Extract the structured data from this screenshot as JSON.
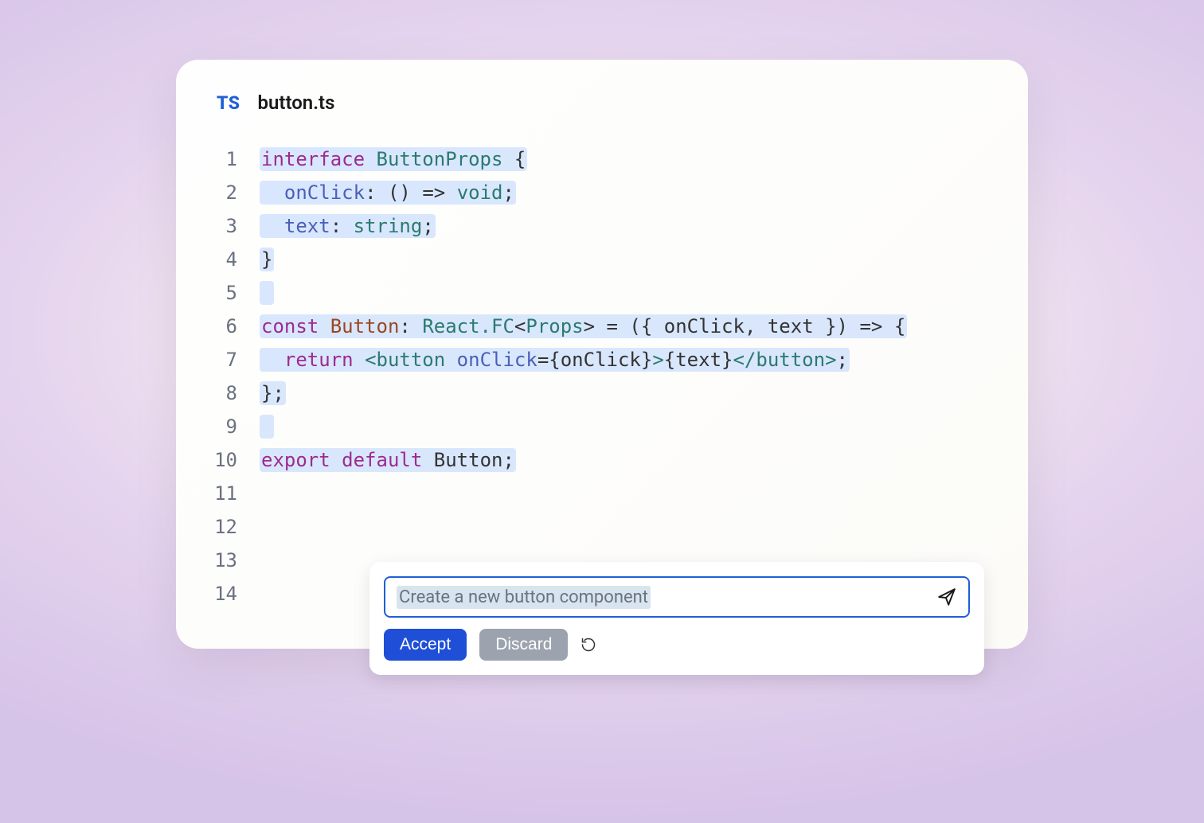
{
  "file": {
    "language_badge": "TS",
    "name": "button.ts"
  },
  "code": {
    "line_count": 14,
    "lines": {
      "l1": {
        "n": "1"
      },
      "l2": {
        "n": "2"
      },
      "l3": {
        "n": "3"
      },
      "l4": {
        "n": "4"
      },
      "l5": {
        "n": "5"
      },
      "l6": {
        "n": "6"
      },
      "l7": {
        "n": "7"
      },
      "l8": {
        "n": "8"
      },
      "l9": {
        "n": "9"
      },
      "l10": {
        "n": "10"
      },
      "l11": {
        "n": "11"
      },
      "l12": {
        "n": "12"
      },
      "l13": {
        "n": "13"
      },
      "l14": {
        "n": "14"
      }
    },
    "tokens": {
      "kw_interface": "interface",
      "ButtonProps": "ButtonProps",
      "brace_open": "{",
      "brace_close": "}",
      "onClick_field": "onClick",
      "colon": ":",
      "parens_empty": "()",
      "arrow": "=>",
      "void": "void",
      "semi": ";",
      "text_field": "text",
      "string_t": "string",
      "kw_const": "const",
      "Button": "Button",
      "ReactFC": "React.FC",
      "lt": "<",
      "Props": "Props",
      "gt": ">",
      "eq": "=",
      "destruct_open": "({",
      "comma": ",",
      "destruct_close": "})",
      "kw_return": "return",
      "tag_button_open": "<button",
      "attr_onClick": "onClick",
      "expr_onClick": "{onClick}",
      "gt2": ">",
      "expr_text": "{text}",
      "tag_button_close": "</button>",
      "close_brace_semi": "};",
      "kw_export": "export",
      "kw_default": "default",
      "space": " ",
      "indent": "  "
    }
  },
  "prompt": {
    "value": "Create a new button component",
    "placeholder": "",
    "accept_label": "Accept",
    "discard_label": "Discard"
  },
  "icons": {
    "send": "send-icon",
    "refresh": "refresh-icon"
  },
  "colors": {
    "accent": "#1e5fd6",
    "accept": "#1e4fd6",
    "discard": "#9ca3af"
  }
}
